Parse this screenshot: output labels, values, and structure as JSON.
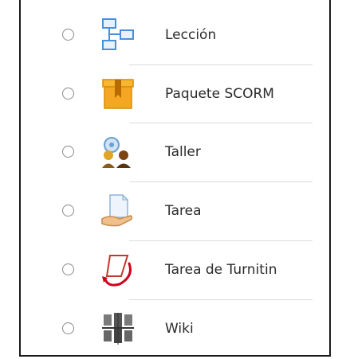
{
  "activity_chooser": {
    "items": [
      {
        "label": "Lección",
        "icon": "lesson-icon"
      },
      {
        "label": "Paquete SCORM",
        "icon": "scorm-package-icon"
      },
      {
        "label": "Taller",
        "icon": "workshop-icon"
      },
      {
        "label": "Tarea",
        "icon": "assignment-icon"
      },
      {
        "label": "Tarea de Turnitin",
        "icon": "turnitin-icon"
      },
      {
        "label": "Wiki",
        "icon": "wiki-icon"
      }
    ]
  },
  "colors": {
    "lesson_blue": "#4a90d9",
    "scorm_orange": "#f5a623",
    "turnitin_red": "#d0021b",
    "wiki_gray": "#555555",
    "divider": "#dcdcdc",
    "text": "#2b2b2b"
  }
}
